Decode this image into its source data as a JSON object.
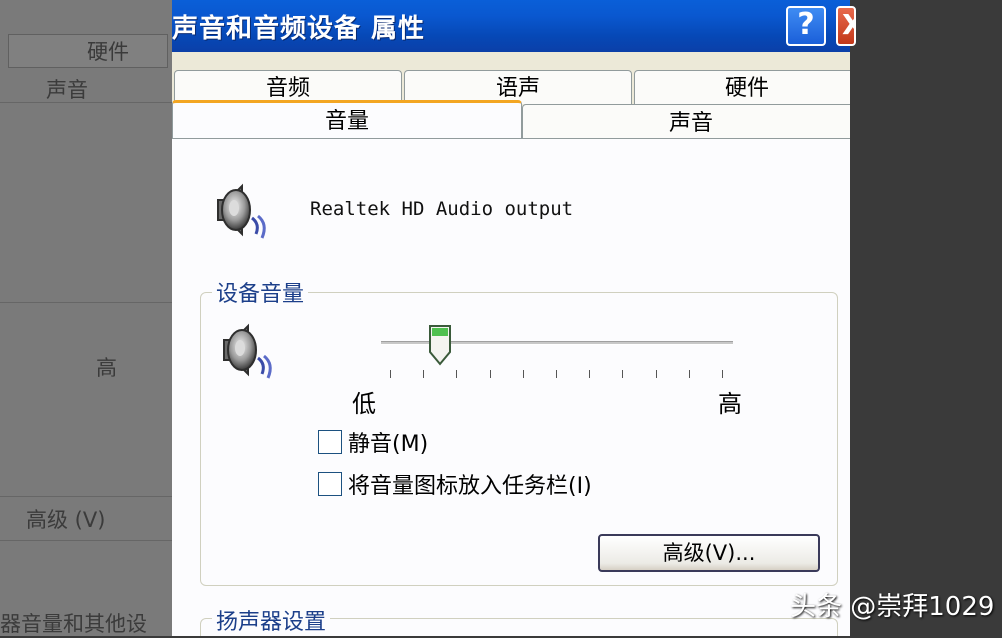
{
  "background_window": {
    "tab_label": "硬件",
    "sound_label": "声音",
    "high_label": "高",
    "advanced_label": "高级 (V)",
    "bottom_text": "器音量和其他设"
  },
  "dialog": {
    "title": "声音和音频设备 属性",
    "help_glyph": "?",
    "close_glyph": "X",
    "tabs_top": [
      "音频",
      "语声",
      "硬件"
    ],
    "tabs_bottom": [
      "音量",
      "声音"
    ],
    "active_tab": "音量",
    "device_name": "Realtek HD Audio output",
    "device_volume_group": {
      "label": "设备音量",
      "volume_level_fraction": 0.15,
      "low_label": "低",
      "high_label": "高",
      "mute_label": "静音(M)",
      "mute_checked": false,
      "taskbar_label": "将音量图标放入任务栏(I)",
      "taskbar_checked": false,
      "advanced_button": "高级(V)..."
    },
    "speaker_settings_group": {
      "label": "扬声器设置"
    }
  },
  "watermark": "头条 @崇拜1029",
  "colors": {
    "titlebar": "#0a58d0",
    "active_tab_accent": "#f3a623",
    "group_label": "#1c3f8a",
    "close_button": "#c2381a"
  },
  "icons": [
    "speaker-icon",
    "help-icon",
    "close-icon"
  ]
}
